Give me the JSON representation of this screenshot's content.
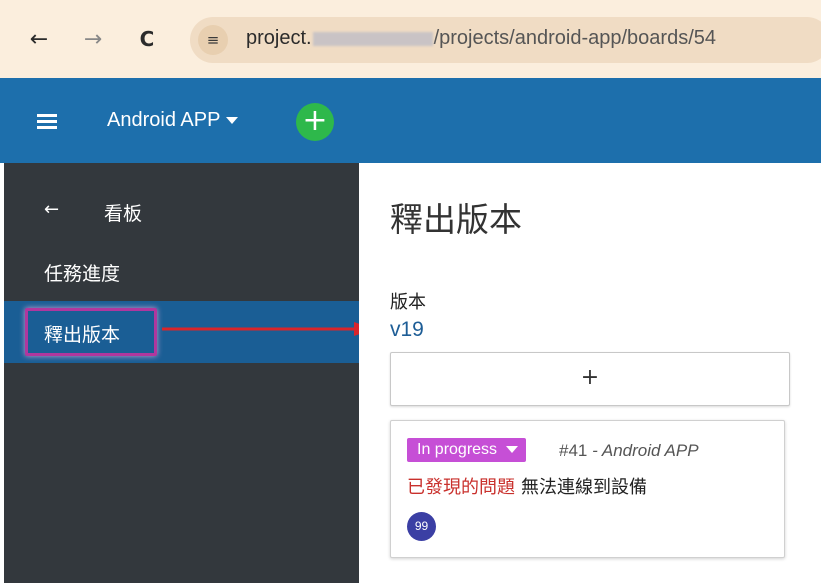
{
  "browser": {
    "back_icon": "←",
    "forward_icon": "→",
    "reload_icon": "C",
    "site_icon": "≡",
    "url_start": "project.",
    "url_end": "/projects/android-app/boards/54"
  },
  "appbar": {
    "menu_icon": "hamburger-icon",
    "project_name": "Android APP",
    "add_icon": "+"
  },
  "sidebar": {
    "back_arrow": "←",
    "title": "看板",
    "items": [
      {
        "label": "任務進度"
      },
      {
        "label": "釋出版本"
      }
    ]
  },
  "main": {
    "page_title": "釋出版本",
    "version_label": "版本",
    "version_value": "v19",
    "add_label": "+",
    "card": {
      "status": "In progress",
      "issue_number": "#41",
      "issue_project": "- Android APP",
      "category": "已發現的問題",
      "title": "無法連線到設備",
      "assignee_initials": "99"
    }
  },
  "colors": {
    "appbar": "#1d6fac",
    "sidebar": "#33383d",
    "sidebar_active": "#1a5e95",
    "status_badge": "#c64fd6",
    "add_button": "#2eb84b",
    "annotation": "#b0379e",
    "arrow": "#d9252a"
  }
}
